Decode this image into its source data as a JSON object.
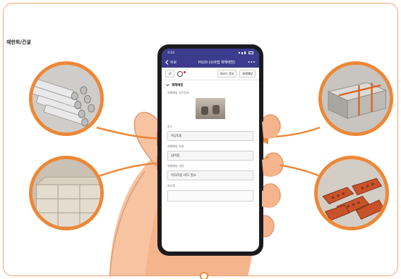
{
  "page_label": "재한회/건설",
  "phone": {
    "status_time": "3:10",
    "appbar": {
      "back_label": "뒤로",
      "title": "HS20 (오버랩 재해예방)",
      "more": "•••"
    },
    "toolbar": {
      "attach_icon": "paperclip-icon",
      "record_icon": "record-icon",
      "code_info_label": "레코드 정보",
      "save_label": "재해예방"
    },
    "section_title": "재해예방",
    "photo_label": "재해예방 사진등록",
    "fields": [
      {
        "label": "장소",
        "value": "지상1층"
      },
      {
        "label": "재해예방 유형",
        "value": "넘어짐"
      },
      {
        "label": "재해예방 내용",
        "value": "미끄러운 바닥 청소"
      },
      {
        "label": "회사명",
        "value": ""
      }
    ]
  },
  "colors": {
    "accent": "#ee8736",
    "appbar": "#3b3c8e",
    "badge": "#e0202a"
  },
  "illustrations": [
    "steel-pipes",
    "concrete-blocks",
    "steel-plates",
    "red-bricks"
  ]
}
